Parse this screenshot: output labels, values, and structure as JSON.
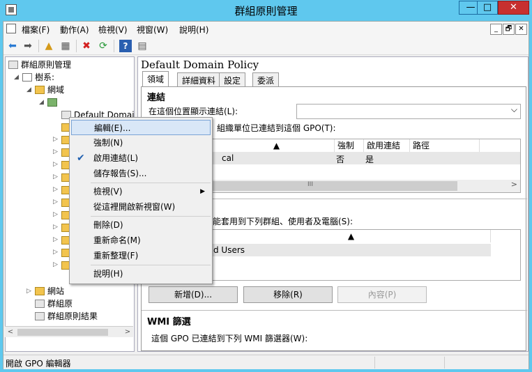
{
  "window": {
    "title": "群組原則管理",
    "min": "—",
    "max": "□",
    "close": "✕"
  },
  "menubar": [
    "檔案(F)",
    "動作(A)",
    "檢視(V)",
    "視窗(W)",
    "說明(H)"
  ],
  "mdi": [
    "_",
    "🗗",
    "✕"
  ],
  "tree": {
    "root": "群組原則管理",
    "forest": "樹系:",
    "domains": "網域",
    "default_domain": "Default Domai",
    "sites": "網站",
    "modeling": "群組原",
    "results": "群組原則結果"
  },
  "right": {
    "gpo_title": "Default Domain Policy",
    "tabs": [
      "領域",
      "詳細資料",
      "設定",
      "委派"
    ],
    "links_heading": "連結",
    "links_label": "在這個位置顯示連結(L):",
    "links_desc": "組織單位已連結到這個 GPO(T):",
    "links_cols": [
      "強制",
      "啟用連結",
      "路徑"
    ],
    "links_row": {
      "name": "cal",
      "enforced": "否",
      "enabled": "是"
    },
    "filter_desc": "只能套用到下列群組、使用者及電腦(S):",
    "filter_row": "d Users",
    "buttons": {
      "add": "新增(D)...",
      "remove": "移除(R)",
      "properties": "內容(P)"
    },
    "wmi_heading": "WMI 篩選",
    "wmi_desc": "這個 GPO 已連結到下列 WMI 篩選器(W):"
  },
  "context_menu": {
    "edit": "編輯(E)...",
    "enforce": "強制(N)",
    "link_enabled": "啟用連結(L)",
    "save_report": "儲存報告(S)...",
    "view": "檢視(V)",
    "new_window": "從這裡開啟新視窗(W)",
    "delete": "刪除(D)",
    "rename": "重新命名(M)",
    "refresh": "重新整理(F)",
    "help": "說明(H)"
  },
  "status": "開啟 GPO 編輯器"
}
